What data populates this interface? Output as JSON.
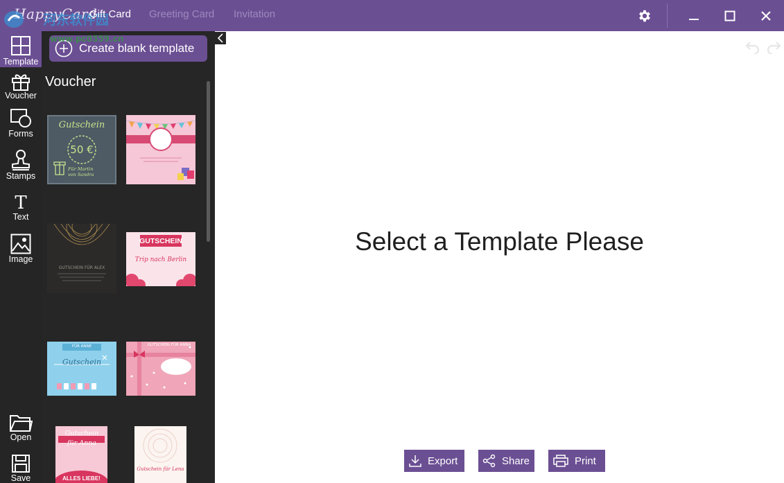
{
  "app": {
    "logo_text": "HappyCard",
    "watermark_text": "河东软件园",
    "watermark_url": "www.pc0359.cn"
  },
  "tabs": [
    {
      "label": "Gift Card",
      "active": true
    },
    {
      "label": "Greeting Card",
      "active": false
    },
    {
      "label": "Invitation",
      "active": false
    }
  ],
  "sidebar": {
    "items": [
      {
        "label": "Template",
        "icon": "template-icon",
        "active": true
      },
      {
        "label": "Voucher",
        "icon": "gift-icon"
      },
      {
        "label": "Forms",
        "icon": "shapes-icon"
      },
      {
        "label": "Stamps",
        "icon": "stamp-icon"
      },
      {
        "label": "Text",
        "icon": "text-icon"
      },
      {
        "label": "Image",
        "icon": "image-icon"
      }
    ],
    "bottom_items": [
      {
        "label": "Open",
        "icon": "folder-icon"
      },
      {
        "label": "Save",
        "icon": "save-icon"
      }
    ]
  },
  "panel": {
    "create_label": "Create blank template",
    "section_title": "Voucher",
    "templates": [
      {
        "heading": "Gutschein",
        "value": "50 €",
        "subtitle": "Für Martin von Sandra"
      },
      {
        "heading": "",
        "value": "",
        "subtitle": ""
      },
      {
        "heading": "",
        "value": "",
        "subtitle": "GUTSCHEIN FÜR ALEX"
      },
      {
        "heading": "GUTSCHEIN",
        "value": "",
        "subtitle": "Trip nach Berlin"
      },
      {
        "heading": "Gutschein",
        "value": "",
        "subtitle": "FÜR ANNE"
      },
      {
        "heading": "GUTSCHEIN FÜR ANNA",
        "value": "",
        "subtitle": ""
      },
      {
        "heading": "Gutschein für Anna",
        "value": "",
        "subtitle": "ALLES LIEBE!"
      },
      {
        "heading": "",
        "value": "",
        "subtitle": "Gutschein für Lena"
      }
    ]
  },
  "canvas": {
    "placeholder": "Select a Template Please"
  },
  "actions": {
    "export_label": "Export",
    "share_label": "Share",
    "print_label": "Print"
  },
  "colors": {
    "accent": "#6b4f93",
    "sidebar_bg": "#252526",
    "panel_bg": "#262626"
  }
}
